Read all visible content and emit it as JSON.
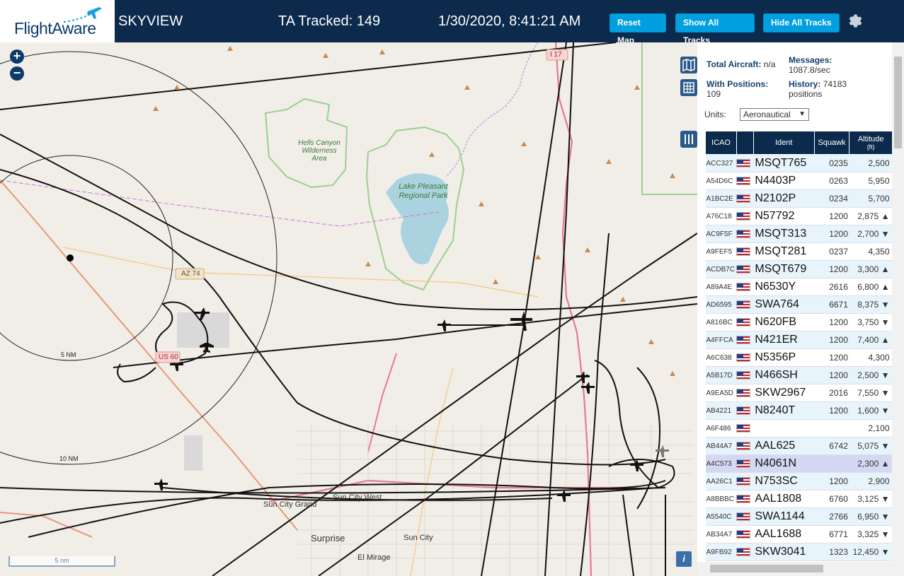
{
  "header": {
    "logo": "FlightAware",
    "app_title": "SKYVIEW",
    "tracked": "TA Tracked: 149",
    "datetime": "1/30/2020, 8:41:21 AM",
    "buttons": {
      "reset": "Reset Map",
      "show_all": "Show All Tracks",
      "hide_all": "Hide All Tracks"
    }
  },
  "map": {
    "zoom_in": "+",
    "zoom_out": "−",
    "scale": "5 nm",
    "labels": {
      "hells_canyon": "Hells Canyon Wilderness Area",
      "lake_pleasant": "Lake Pleasant Regional Park",
      "az74": "AZ 74",
      "us60": "US 60",
      "i17": "I 17",
      "range5": "5 NM",
      "range10": "10 NM",
      "sun_city_grand": "Sun City Grand",
      "sun_city_west": "Sun City West",
      "surprise": "Surprise",
      "sun_city": "Sun City",
      "el_mirage": "El Mirage"
    },
    "info": "i"
  },
  "stats": {
    "total_label": "Total Aircraft:",
    "total_value": "n/a",
    "messages_label": "Messages:",
    "messages_value": "1087.8/sec",
    "positions_label": "With Positions:",
    "positions_value": "109",
    "history_label": "History:",
    "history_value_1": "74183",
    "history_value_2": "positions",
    "units_label": "Units:",
    "units_value": "Aeronautical"
  },
  "table": {
    "headers": {
      "icao": "ICAO",
      "ident": "Ident",
      "squawk": "Squawk",
      "altitude_1": "Altitude",
      "altitude_2": "(ft)"
    },
    "rows": [
      {
        "icao": "ACC327",
        "ident": "MSQT765",
        "squawk": "0235",
        "alt": "2,500"
      },
      {
        "icao": "A54D6C",
        "ident": "N4403P",
        "squawk": "0263",
        "alt": "5,950"
      },
      {
        "icao": "A1BC2E",
        "ident": "N2102P",
        "squawk": "0234",
        "alt": "5,700"
      },
      {
        "icao": "A76C18",
        "ident": "N57792",
        "squawk": "1200",
        "alt": "2,875 ▲"
      },
      {
        "icao": "AC9F5F",
        "ident": "MSQT313",
        "squawk": "1200",
        "alt": "2,700 ▼"
      },
      {
        "icao": "A9FEF5",
        "ident": "MSQT281",
        "squawk": "0237",
        "alt": "4,350"
      },
      {
        "icao": "ACDB7C",
        "ident": "MSQT679",
        "squawk": "1200",
        "alt": "3,300 ▲"
      },
      {
        "icao": "A89A4E",
        "ident": "N6530Y",
        "squawk": "2616",
        "alt": "6,800 ▲"
      },
      {
        "icao": "AD6595",
        "ident": "SWA764",
        "squawk": "6671",
        "alt": "8,375 ▼"
      },
      {
        "icao": "A816BC",
        "ident": "N620FB",
        "squawk": "1200",
        "alt": "3,750 ▼"
      },
      {
        "icao": "A4FFCA",
        "ident": "N421ER",
        "squawk": "1200",
        "alt": "7,400 ▲"
      },
      {
        "icao": "A6C638",
        "ident": "N5356P",
        "squawk": "1200",
        "alt": "4,300"
      },
      {
        "icao": "A5B17D",
        "ident": "N466SH",
        "squawk": "1200",
        "alt": "2,500 ▼"
      },
      {
        "icao": "A9EA5D",
        "ident": "SKW2967",
        "squawk": "2016",
        "alt": "7,550 ▼"
      },
      {
        "icao": "AB4221",
        "ident": "N8240T",
        "squawk": "1200",
        "alt": "1,600 ▼"
      },
      {
        "icao": "A6F486",
        "ident": "",
        "squawk": "",
        "alt": "2,100"
      },
      {
        "icao": "AB44A7",
        "ident": "AAL625",
        "squawk": "6742",
        "alt": "5,075 ▼"
      },
      {
        "icao": "A4C573",
        "ident": "N4061N",
        "squawk": "",
        "alt": "2,300 ▲"
      },
      {
        "icao": "AA26C1",
        "ident": "N753SC",
        "squawk": "1200",
        "alt": "2,900"
      },
      {
        "icao": "A8BBBC",
        "ident": "AAL1808",
        "squawk": "6760",
        "alt": "3,125 ▼"
      },
      {
        "icao": "A5540C",
        "ident": "SWA1144",
        "squawk": "2766",
        "alt": "6,950 ▼"
      },
      {
        "icao": "AB34A7",
        "ident": "AAL1688",
        "squawk": "6771",
        "alt": "3,325 ▼"
      },
      {
        "icao": "A9FB92",
        "ident": "SKW3041",
        "squawk": "1323",
        "alt": "12,450 ▼"
      }
    ]
  },
  "colors": {
    "header_bg": "#0b2a4c",
    "button_bg": "#00a0e0",
    "map_bg": "#f1eee8",
    "water": "#aad3df",
    "park_border": "#8fc98a"
  }
}
